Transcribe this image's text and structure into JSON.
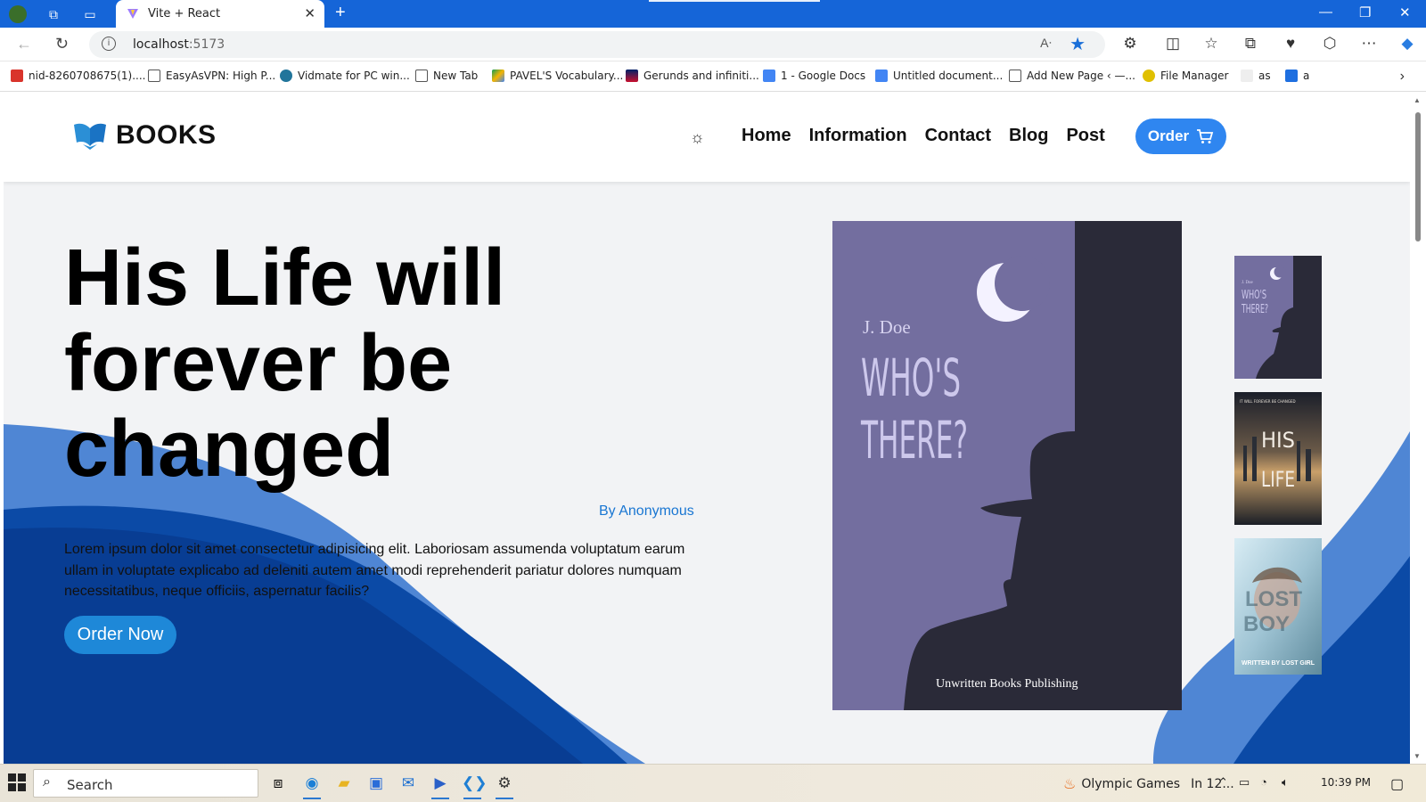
{
  "browser": {
    "tab_title": "Vite + React",
    "url_host": "localhost",
    "url_port": ":5173",
    "bookmarks": [
      {
        "label": "nid-8260708675(1)....",
        "icon": "pdf-icon",
        "color": "#d9342b"
      },
      {
        "label": "EasyAsVPN: High P...",
        "icon": "page-icon",
        "color": "#555555"
      },
      {
        "label": "Vidmate for PC win...",
        "icon": "wordpress-icon",
        "color": "#21759b"
      },
      {
        "label": "New Tab",
        "icon": "page-icon",
        "color": "#555555"
      },
      {
        "label": "PAVEL'S Vocabulary...",
        "icon": "drive-icon",
        "color": "#f4b400"
      },
      {
        "label": "Gerunds and infiniti...",
        "icon": "uk-flag-icon",
        "color": "#c8102e"
      },
      {
        "label": "1 - Google Docs",
        "icon": "docs-icon",
        "color": "#4285f4"
      },
      {
        "label": "Untitled document...",
        "icon": "docs-icon",
        "color": "#4285f4"
      },
      {
        "label": "Add New Page ‹ —...",
        "icon": "page-icon",
        "color": "#555555"
      },
      {
        "label": "File Manager",
        "icon": "file-manager-icon",
        "color": "#e0c000"
      },
      {
        "label": "as",
        "icon": "blank-icon",
        "color": "#eeeeee"
      },
      {
        "label": "a",
        "icon": "app-icon",
        "color": "#1e6fe0"
      }
    ]
  },
  "site": {
    "brand": "BOOKS",
    "nav": [
      "Home",
      "Information",
      "Contact",
      "Blog",
      "Post"
    ],
    "order_label": "Order",
    "hero": {
      "title": "His Life will forever be changed",
      "author": "By Anonymous",
      "description": "Lorem ipsum dolor sit amet consectetur adipisicing elit. Laboriosam assumenda voluptatum earum ullam in voluptate explicabo ad deleniti autem amet modi reprehenderit pariatur dolores numquam necessitatibus, neque officiis, aspernatur facilis?",
      "cta": "Order Now"
    },
    "main_cover": {
      "author": "J. Doe",
      "title_line1": "WHO'S",
      "title_line2": "THERE?",
      "publisher": "Unwritten Books Publishing"
    },
    "thumbnails": [
      {
        "name": "whos-there-thumb",
        "line1": "J. Doe",
        "line2": "WHO'S",
        "line3": "THERE?"
      },
      {
        "name": "his-life-thumb",
        "line1": "IT WILL FOREVER BE CHANGED",
        "line2": "HIS",
        "line3": "LIFE"
      },
      {
        "name": "lost-boy-thumb",
        "line1": "LOST",
        "line2": "BOY",
        "line3": "WRITTEN BY LOST GIRL"
      }
    ]
  },
  "taskbar": {
    "search_placeholder": "Search",
    "news": "Olympic Games",
    "news_time": "In 12...",
    "clock": "10:39 PM"
  },
  "colors": {
    "accent": "#2f86f0",
    "cta": "#1e88d8",
    "author_link": "#1976d2",
    "wave_dark": "#0a3f9c",
    "wave_light": "#4d83d2",
    "cover_purple": "#736e9f",
    "cover_dark": "#2a2a38"
  }
}
